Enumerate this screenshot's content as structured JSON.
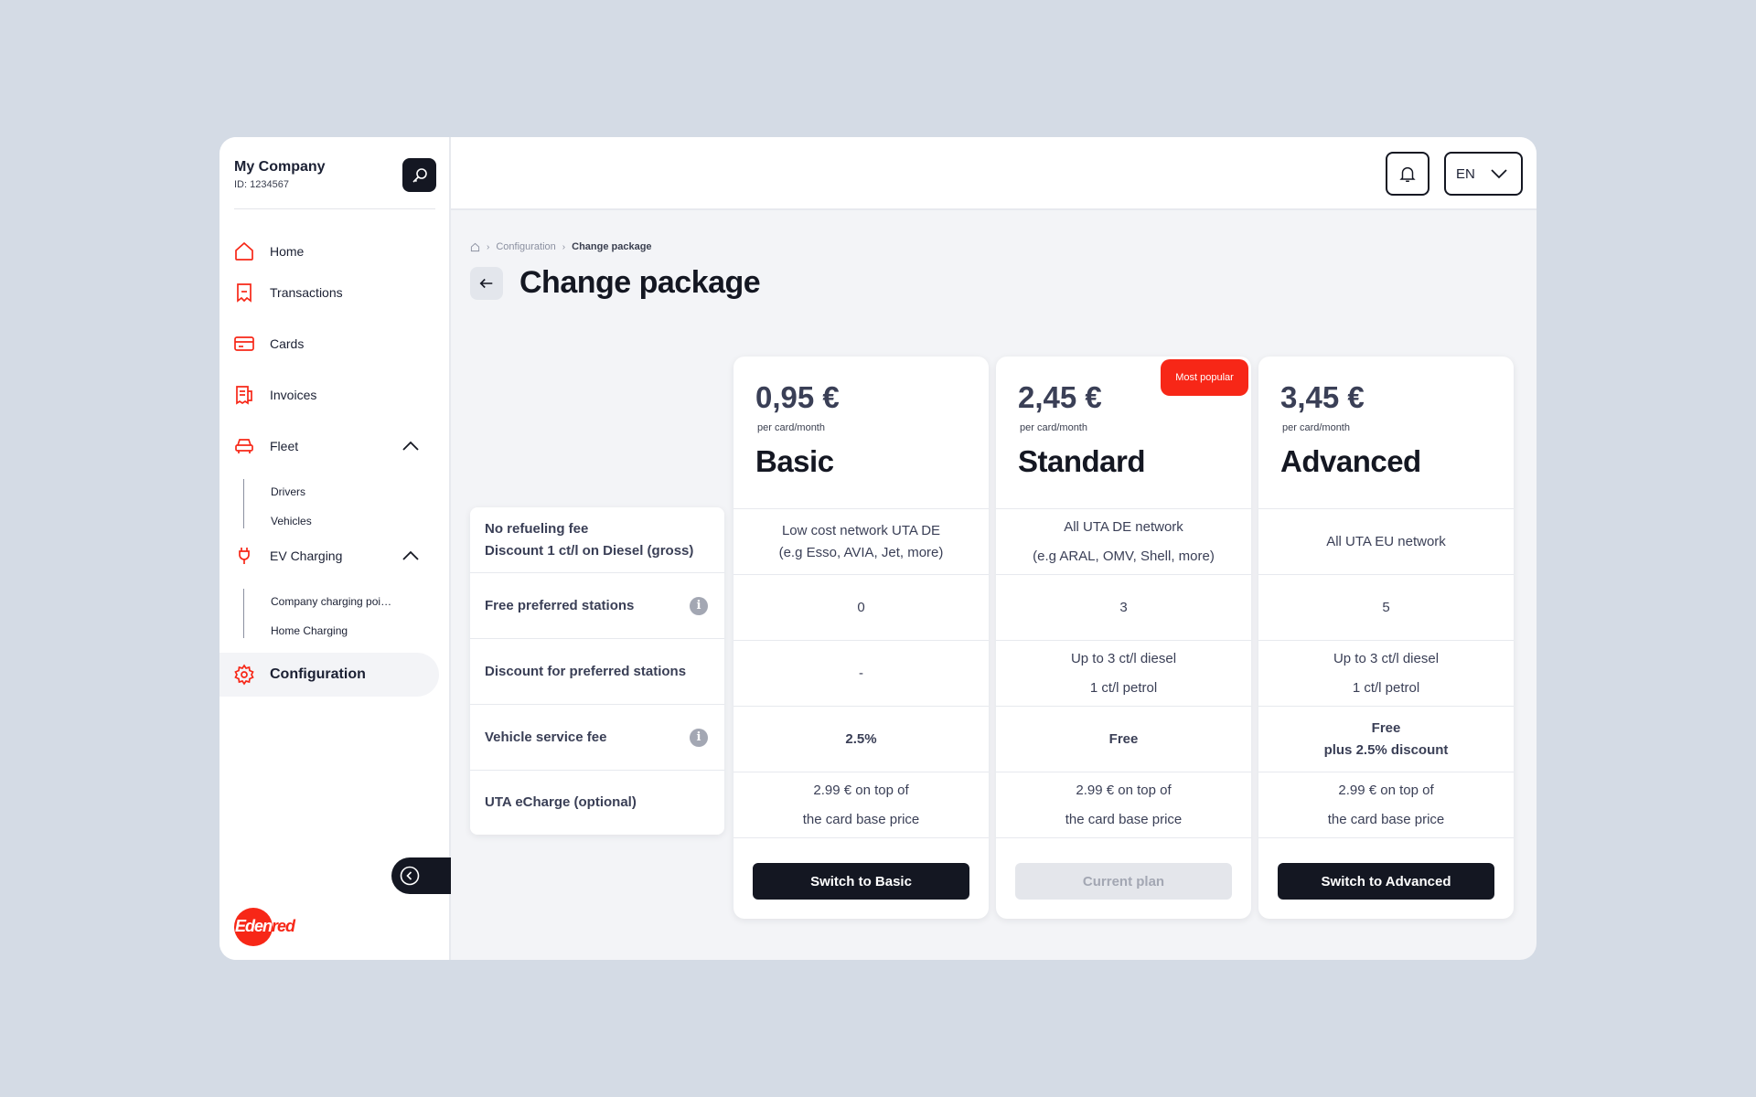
{
  "company": {
    "name": "My Company",
    "id": "ID: 1234567"
  },
  "sidebar": {
    "items": [
      {
        "label": "Home",
        "icon": "home-icon"
      },
      {
        "label": "Transactions",
        "icon": "receipt-icon"
      },
      {
        "label": "Cards",
        "icon": "card-icon"
      },
      {
        "label": "Invoices",
        "icon": "invoice-icon"
      },
      {
        "label": "Fleet",
        "icon": "car-icon",
        "expanded": true,
        "children": [
          "Drivers",
          "Vehicles"
        ]
      },
      {
        "label": "EV Charging",
        "icon": "plug-icon",
        "expanded": true,
        "children": [
          "Company charging poi…",
          "Home Charging"
        ]
      },
      {
        "label": "Configuration",
        "icon": "gear-icon",
        "active": true
      }
    ]
  },
  "header": {
    "language": "EN"
  },
  "breadcrumb": {
    "parent": "Configuration",
    "current": "Change package"
  },
  "page": {
    "title": "Change package"
  },
  "features": [
    {
      "label_line1": "No refueling fee",
      "label_line2": "Discount 1 ct/l on Diesel (gross)"
    },
    {
      "label": "Free preferred stations",
      "info": true
    },
    {
      "label": "Discount for preferred stations"
    },
    {
      "label": "Vehicle service fee",
      "info": true
    },
    {
      "label": "UTA eCharge (optional)"
    }
  ],
  "plans": [
    {
      "price": "0,95 €",
      "per": "per card/month",
      "name": "Basic",
      "cells": [
        [
          "Low cost network UTA DE",
          "(e.g Esso, AVIA, Jet, more)"
        ],
        [
          "0"
        ],
        [
          "-"
        ],
        [
          "2.5%"
        ],
        [
          "2.99 € on top of",
          "the card base price"
        ]
      ],
      "button": "Switch to Basic"
    },
    {
      "price": "2,45 €",
      "per": "per card/month",
      "name": "Standard",
      "badge": "Most popular",
      "cells": [
        [
          "All UTA DE network",
          "(e.g ARAL, OMV, Shell, more)"
        ],
        [
          "3"
        ],
        [
          "Up to 3 ct/l diesel",
          "1 ct/l petrol"
        ],
        [
          "Free"
        ],
        [
          "2.99 € on top of",
          "the card base price"
        ]
      ],
      "button": "Current plan"
    },
    {
      "price": "3,45 €",
      "per": "per card/month",
      "name": "Advanced",
      "cells": [
        [
          "All UTA EU network"
        ],
        [
          "5"
        ],
        [
          "Up to 3 ct/l diesel",
          "1 ct/l petrol"
        ],
        [
          "Free",
          "plus 2.5% discount"
        ],
        [
          "2.99 € on top of",
          "the card base price"
        ]
      ],
      "button": "Switch to Advanced"
    }
  ],
  "brand": {
    "logo_text": "Edenred",
    "accent": "#f72717",
    "dark": "#141722"
  }
}
